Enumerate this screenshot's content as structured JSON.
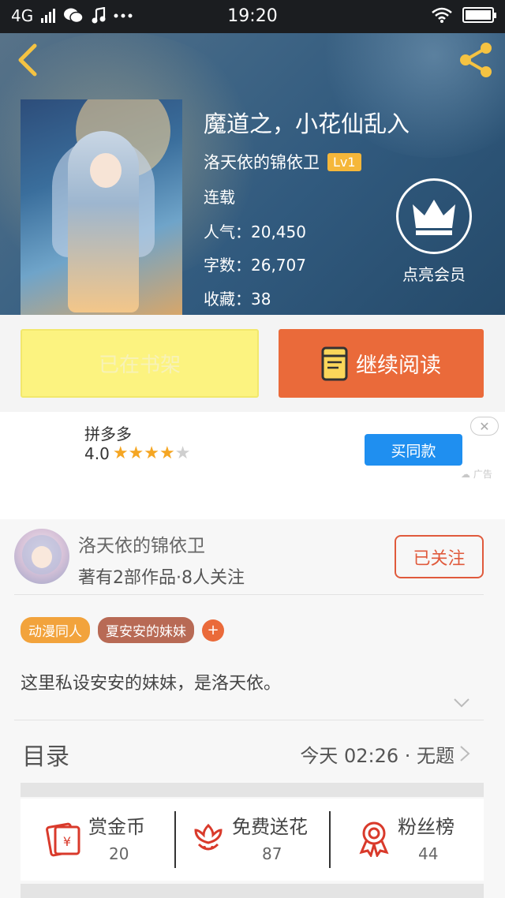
{
  "status_bar": {
    "network": "4G",
    "time": "19:20"
  },
  "book": {
    "title": "魔道之，小花仙乱入",
    "author": "洛天依的锦依卫",
    "author_level": "Lv1",
    "status": "连载",
    "popularity_label": "人气：20,450",
    "word_count_label": "字数：26,707",
    "favorites_label": "收藏：38"
  },
  "vip": {
    "label": "点亮会员"
  },
  "actions": {
    "shelf_label": "已在书架",
    "read_label": "继续阅读"
  },
  "ad": {
    "app_name": "拼多多",
    "rating": "4.0",
    "stars_filled": 4,
    "stars_total": 5,
    "button_label": "买同款",
    "close_symbol": "✕",
    "tag": "广告"
  },
  "author_section": {
    "name": "洛天依的锦依卫",
    "stats": "著有2部作品·8人关注",
    "follow_label": "已关注",
    "tags": [
      {
        "label": "动漫同人",
        "color": "#f2a33c"
      },
      {
        "label": "夏安安的妹妹",
        "color": "#b86a55"
      }
    ],
    "tag_add": "+",
    "description": "这里私设安安的妹妹，是洛天依。"
  },
  "toc": {
    "title": "目录",
    "latest": "今天 02:26 · 无题"
  },
  "stats": [
    {
      "label": "赏金币",
      "value": "20",
      "icon": "red-envelope-icon"
    },
    {
      "label": "免费送花",
      "value": "87",
      "icon": "flower-icon"
    },
    {
      "label": "粉丝榜",
      "value": "44",
      "icon": "award-ribbon-icon"
    }
  ],
  "colors": {
    "accent": "#ea6a3a",
    "shelf": "#fcf380",
    "ad_button": "#1f8ff0",
    "icon_red": "#d93a2b"
  }
}
